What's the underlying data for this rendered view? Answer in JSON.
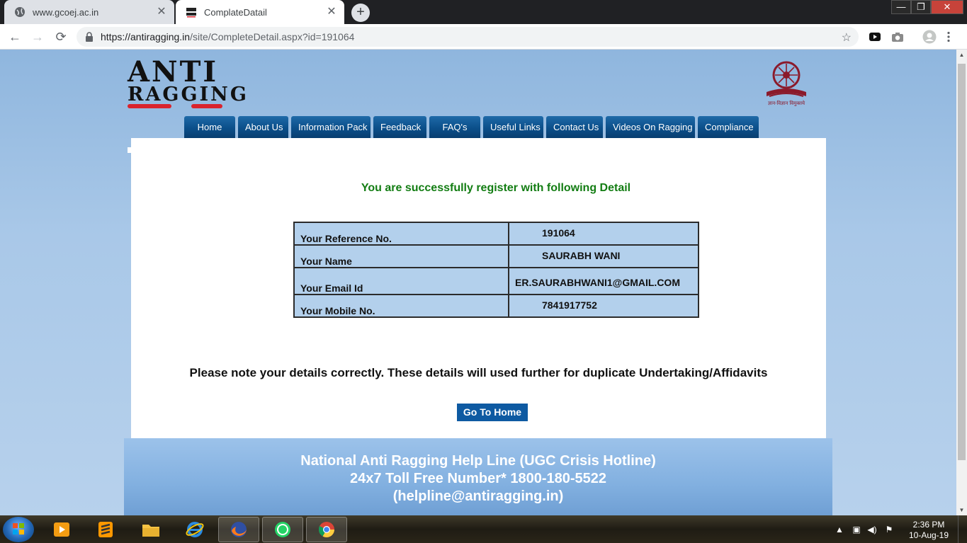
{
  "browser": {
    "tabs": [
      {
        "title": "www.gcoej.ac.in",
        "close": "✕"
      },
      {
        "title": "ComplateDatail",
        "close": "✕"
      }
    ],
    "new_tab": "+",
    "window_controls": {
      "minimize": "—",
      "maximize": "❐",
      "close": "✕"
    },
    "url_host": "https://antiragging.in",
    "url_path": "/site/CompleteDetail.aspx?id=191064",
    "nav_icons": {
      "back": "←",
      "forward": "→",
      "reload": "⟳"
    },
    "star": "☆"
  },
  "site": {
    "logo_line1": "ANTI",
    "logo_line2": "RAGGING",
    "ugc_caption": "ज्ञान-विज्ञान विमुक्तये",
    "nav": [
      "Home",
      "About Us",
      "Information Pack",
      "Feedback",
      "FAQ's",
      "Useful Links",
      "Contact Us",
      "Videos On Ragging",
      "Compliance"
    ]
  },
  "main": {
    "success_msg": "You are successfully register with following Detail",
    "details": [
      {
        "label": "Your Reference No.",
        "value": "191064"
      },
      {
        "label": "Your Name",
        "value": "SAURABH WANI"
      },
      {
        "label": "Your Email Id",
        "value": "ER.SAURABHWANI1@GMAIL.COM"
      },
      {
        "label": "Your Mobile No.",
        "value": "7841917752"
      }
    ],
    "note": "Please note your details correctly. These details will used further for duplicate Undertaking/Affidavits",
    "go_home_label": "Go To Home"
  },
  "helpline": {
    "line1": "National Anti Ragging Help Line (UGC Crisis Hotline)",
    "line2": "24x7 Toll Free Number* 1800-180-5522",
    "line3": "(helpline@antiragging.in)"
  },
  "taskbar": {
    "time": "2:36 PM",
    "date": "10-Aug-19"
  },
  "colors": {
    "success": "#137d13",
    "nav_blue": "#0b4f8a",
    "table_fill": "#b3d0ec",
    "button_blue": "#0e5aa2"
  }
}
